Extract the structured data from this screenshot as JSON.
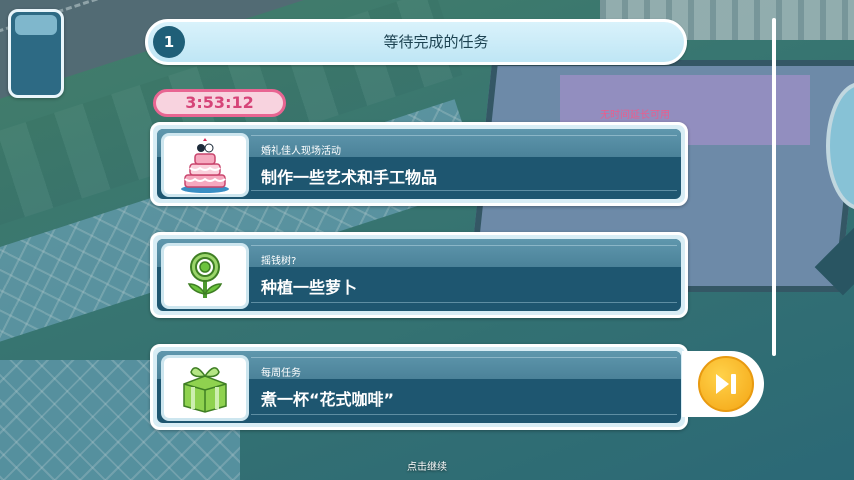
{
  "header": {
    "number": "1",
    "title": "等待完成的任务"
  },
  "timer": {
    "value": "3:53:12",
    "no_extend_note": "无时间延长可用"
  },
  "tasks": [
    {
      "subtitle": "婚礼佳人现场活动",
      "title": "制作一些艺术和手工物品",
      "icon": "wedding-cake-icon"
    },
    {
      "subtitle": "摇钱树?",
      "title": "种植一些萝卜",
      "icon": "flower-icon"
    },
    {
      "subtitle": "每周任务",
      "title": "煮一杯“花式咖啡”",
      "icon": "gift-box-icon"
    }
  ],
  "skip_button": {
    "icon": "skip-forward-icon"
  },
  "footer": {
    "continue_label": "点击继续"
  },
  "colors": {
    "accent_pink": "#e86592",
    "card_blue": "#1e5670",
    "skip_gold": "#f4a514"
  }
}
